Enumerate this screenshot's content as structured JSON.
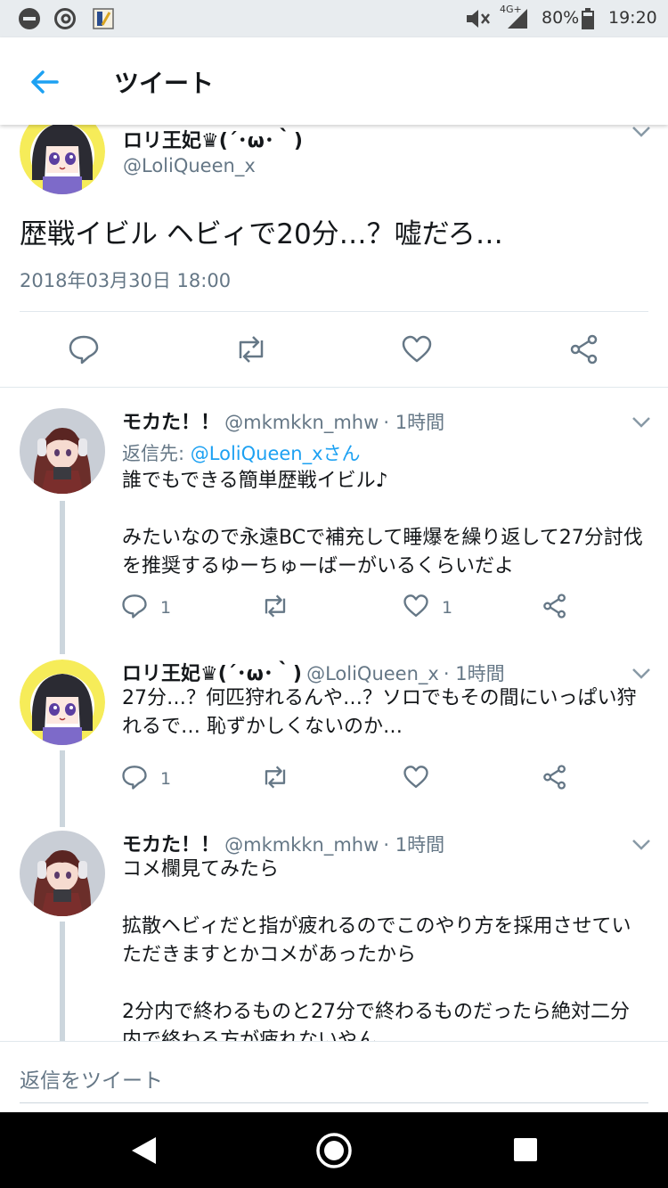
{
  "status_bar": {
    "network": "4G+",
    "battery": "80%",
    "time": "19:20",
    "icons": [
      "do-not-disturb-icon",
      "at-sign-icon",
      "app-notification-icon",
      "mute-icon",
      "signal-icon",
      "battery-icon"
    ]
  },
  "app_bar": {
    "title": "ツイート",
    "back_icon": "arrow-left-icon"
  },
  "main_tweet": {
    "name": "ロリ王妃♛(´･ω･｀)",
    "handle": "@LoliQueen_x",
    "text": "歴戦イビル ヘビィで20分…？嘘だろ…",
    "timestamp": "2018年03月30日 18:00",
    "actions": [
      "reply-icon",
      "retweet-icon",
      "like-icon",
      "share-icon"
    ]
  },
  "replies": [
    {
      "name": "モカた！！",
      "handle": "@mkmkkn_mhw",
      "time": "· 1時間",
      "reply_to_label": "返信先: ",
      "reply_to_handle": "@LoliQueen_xさん",
      "text": "誰でもできる簡単歴戦イビル♪\n\nみたいなので永遠BCで補充して睡爆を繰り返して27分討伐を推奨するゆーちゅーばーがいるくらいだよ",
      "reply_count": "1",
      "like_count": "1"
    },
    {
      "name": "ロリ王妃♛(´･ω･｀)",
      "handle": "@LoliQueen_x",
      "time": "· 1時間",
      "text": "27分…？何匹狩れるんや…？ソロでもその間にいっぱい狩れるで… 恥ずかしくないのか…",
      "reply_count": "1",
      "like_count": ""
    },
    {
      "name": "モカた！！",
      "handle": "@mkmkkn_mhw",
      "time": "· 1時間",
      "text": "コメ欄見てみたら\n\n拡散ヘビィだと指が疲れるのでこのやり方を採用させていただきますとかコメがあったから\n\n2分内で終わるものと27分で終わるものだったら絶対二分内で終わる方が疲れないやん…"
    }
  ],
  "reply_bar": {
    "placeholder": "返信をツイート"
  },
  "nav_bar": {
    "buttons": [
      "back-triangle-icon",
      "home-circle-icon",
      "recents-square-icon"
    ]
  },
  "colors": {
    "accent": "#1da1f2",
    "secondary_text": "#657786",
    "icon_gray": "#657786",
    "divider": "#e1e8ed",
    "status_bar_bg": "#e8ecef"
  }
}
